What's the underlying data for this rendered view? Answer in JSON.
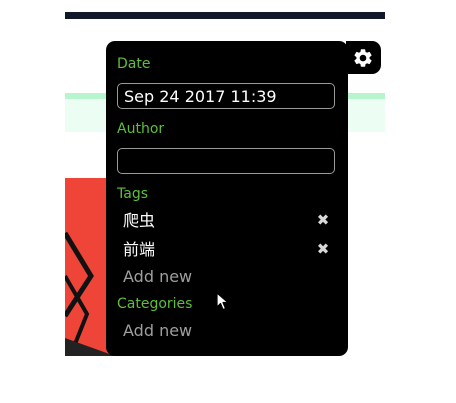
{
  "date": {
    "label": "Date",
    "value": "Sep 24 2017 11:39"
  },
  "author": {
    "label": "Author",
    "value": ""
  },
  "tags": {
    "label": "Tags",
    "items": [
      {
        "text": "爬虫",
        "remove_symbol": "✖"
      },
      {
        "text": "前端",
        "remove_symbol": "✖"
      }
    ],
    "add_new": "Add new"
  },
  "categories": {
    "label": "Categories",
    "add_new": "Add new"
  },
  "icons": {
    "settings": "gear-icon",
    "remove": "close-icon",
    "pointer": "mouse-cursor-icon"
  },
  "colors": {
    "panel_bg": "#000000",
    "label_green": "#5fbf3a",
    "placeholder_gray": "#9e9e9e",
    "accent_red": "#ef4538",
    "band_green": "#ecfdf3"
  }
}
